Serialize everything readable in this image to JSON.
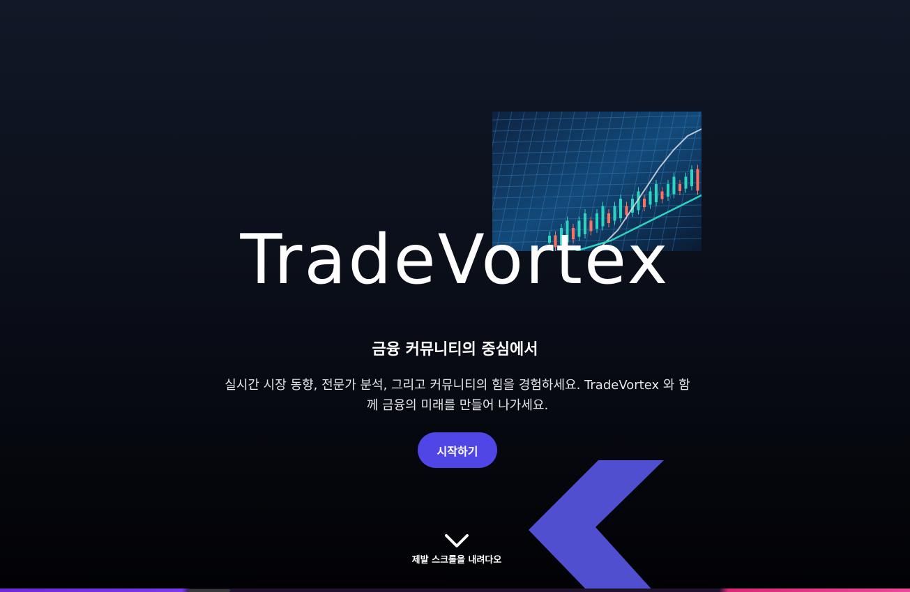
{
  "hero": {
    "brand_title": "TradeVortex",
    "subtitle": "금융 커뮤니티의 중심에서",
    "description": "실시간 시장 동향, 전문가 분석, 그리고 커뮤니티의 힘을 경험하세요. TradeVortex 와 함께 금융의 미래를 만들어 나가세요.",
    "cta_label": "시작하기",
    "scroll_hint": "제발 스크롤을 내려다오",
    "image_icon": "stock-chart-image"
  },
  "colors": {
    "accent": "#4f46e5",
    "arrow": "#4f4fd0",
    "candle_up": "#2dd4bf",
    "candle_down": "#f97360"
  }
}
